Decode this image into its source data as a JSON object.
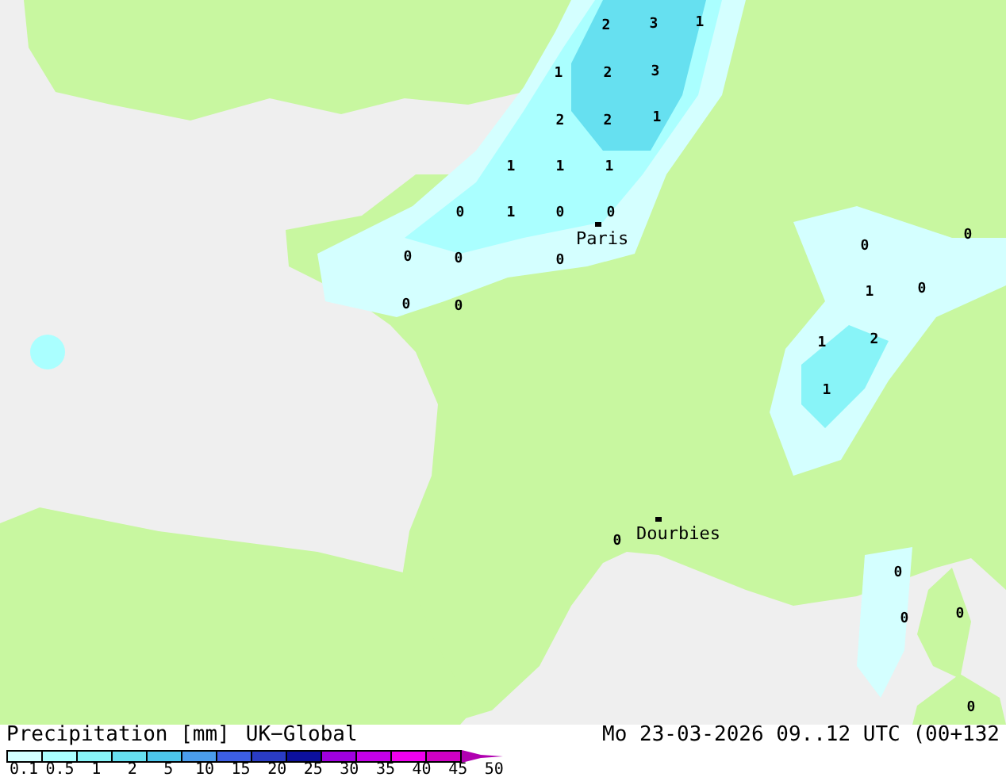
{
  "map": {
    "value_labels": [
      {
        "text": "2"
      },
      {
        "text": "3"
      },
      {
        "text": "1"
      },
      {
        "text": "1"
      },
      {
        "text": "2"
      },
      {
        "text": "3"
      },
      {
        "text": "2"
      },
      {
        "text": "2"
      },
      {
        "text": "1"
      },
      {
        "text": "1"
      },
      {
        "text": "1"
      },
      {
        "text": "1"
      },
      {
        "text": "0"
      },
      {
        "text": "1"
      },
      {
        "text": "0"
      },
      {
        "text": "0"
      },
      {
        "text": "0"
      },
      {
        "text": "0"
      },
      {
        "text": "0"
      },
      {
        "text": "0"
      },
      {
        "text": "0"
      },
      {
        "text": "0"
      },
      {
        "text": "0"
      },
      {
        "text": "1"
      },
      {
        "text": "0"
      },
      {
        "text": "1"
      },
      {
        "text": "2"
      },
      {
        "text": "1"
      },
      {
        "text": "0"
      },
      {
        "text": "0"
      },
      {
        "text": "0"
      },
      {
        "text": "0"
      },
      {
        "text": "0"
      }
    ],
    "places": [
      {
        "name": "Paris"
      },
      {
        "name": "Dourbies"
      }
    ]
  },
  "footer": {
    "title": "Precipitation [mm]",
    "model": "UK−Global",
    "time": "Mo 23-03-2026 09..12 UTC (00+132"
  },
  "legend": {
    "boxes": [
      {
        "color": "#d4ffff"
      },
      {
        "color": "#aaffff"
      },
      {
        "color": "#88f4f8"
      },
      {
        "color": "#66e0f0"
      },
      {
        "color": "#4cc6ec"
      },
      {
        "color": "#4a9cec"
      },
      {
        "color": "#3c5ee4"
      },
      {
        "color": "#2a3cc4"
      },
      {
        "color": "#0c109c"
      },
      {
        "color": "#a000e0"
      },
      {
        "color": "#c400e8"
      },
      {
        "color": "#f000f0"
      },
      {
        "color": "#d000c4"
      }
    ],
    "labels": [
      "0.1",
      "0.5",
      "1",
      "2",
      "5",
      "10",
      "15",
      "20",
      "25",
      "30",
      "35",
      "40",
      "45",
      "50"
    ]
  }
}
